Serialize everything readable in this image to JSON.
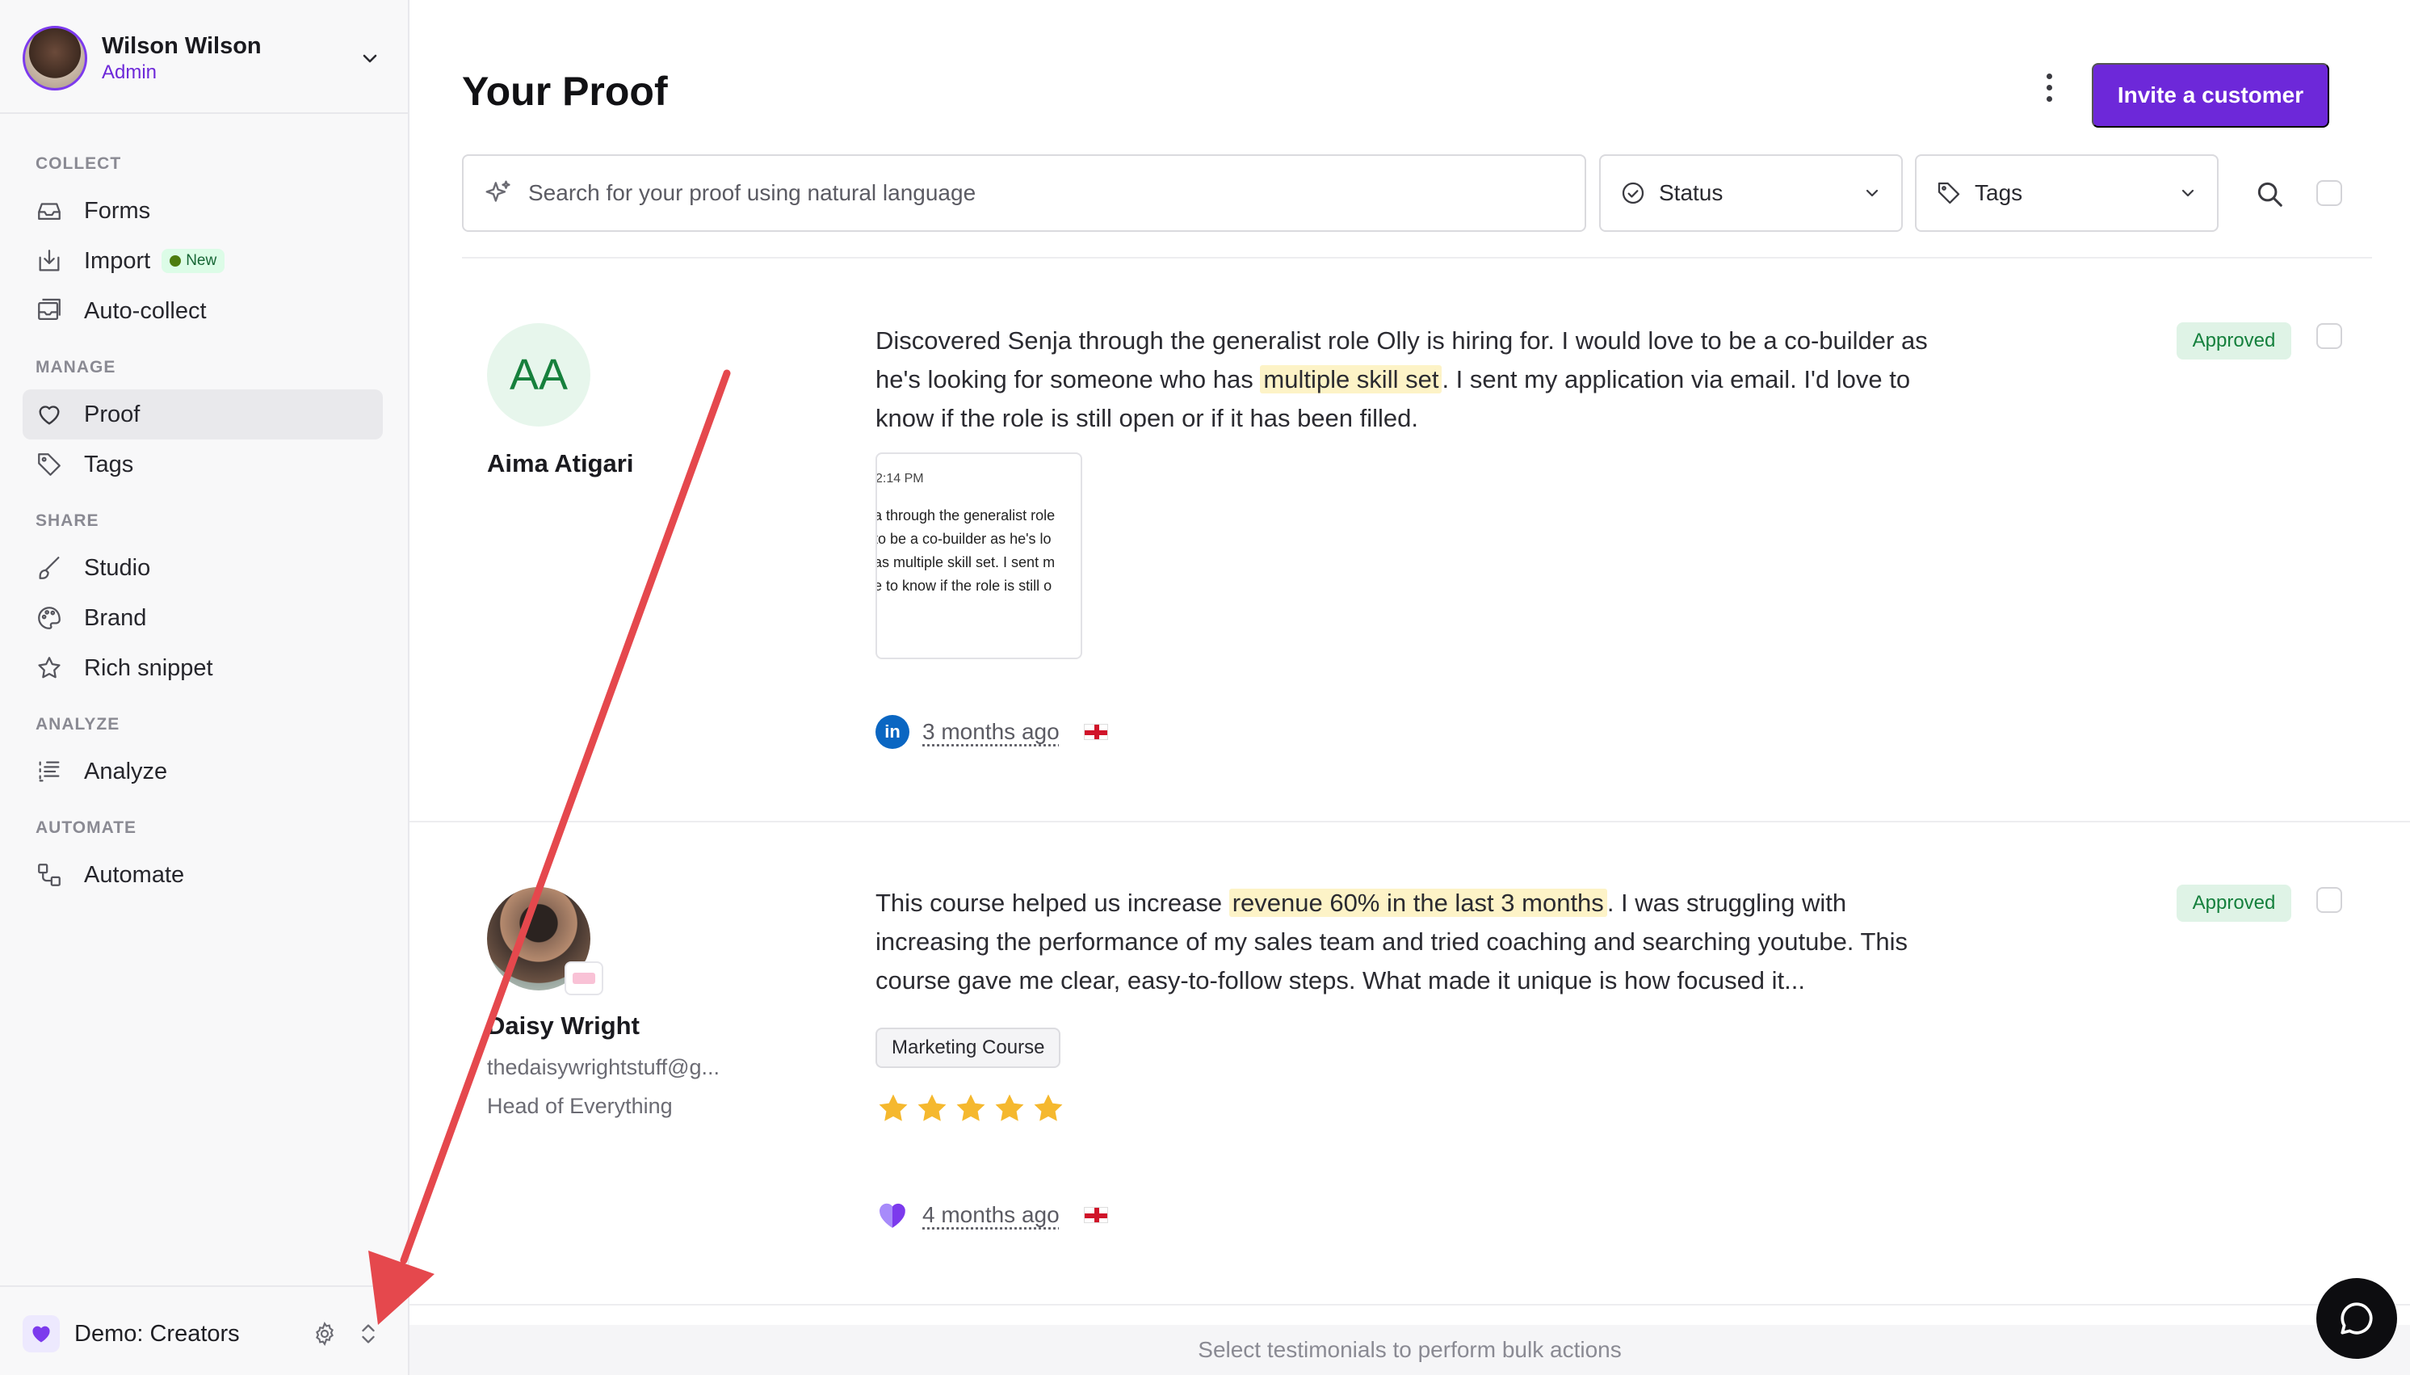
{
  "user": {
    "name": "Wilson Wilson",
    "role": "Admin"
  },
  "sidebar": {
    "sections": [
      {
        "title": "COLLECT",
        "items": [
          {
            "label": "Forms",
            "icon": "inbox-icon"
          },
          {
            "label": "Import",
            "icon": "import-icon",
            "badge": "New"
          },
          {
            "label": "Auto-collect",
            "icon": "auto-collect-icon"
          }
        ]
      },
      {
        "title": "MANAGE",
        "items": [
          {
            "label": "Proof",
            "icon": "heart-icon",
            "active": true
          },
          {
            "label": "Tags",
            "icon": "tag-icon"
          }
        ]
      },
      {
        "title": "SHARE",
        "items": [
          {
            "label": "Studio",
            "icon": "brush-icon"
          },
          {
            "label": "Brand",
            "icon": "palette-icon"
          },
          {
            "label": "Rich snippet",
            "icon": "star-icon"
          }
        ]
      },
      {
        "title": "ANALYZE",
        "items": [
          {
            "label": "Analyze",
            "icon": "analyze-icon"
          }
        ]
      },
      {
        "title": "AUTOMATE",
        "items": [
          {
            "label": "Automate",
            "icon": "automate-icon"
          }
        ]
      }
    ],
    "workspace": {
      "name": "Demo: Creators"
    }
  },
  "header": {
    "title": "Your Proof",
    "invite_label": "Invite a customer"
  },
  "filters": {
    "search_placeholder": "Search for your proof using natural language",
    "status_label": "Status",
    "tags_label": "Tags"
  },
  "testimonials": [
    {
      "initials": "AA",
      "name": "Aima Atigari",
      "quote_before": "Discovered Senja through the generalist role Olly is hiring for. I would love to be a co-builder as he's looking for someone who has ",
      "quote_highlight": "multiple skill set",
      "quote_after": ". I sent my application via email. I'd love to know if the role is still open or if it has been filled.",
      "status": "Approved",
      "attachment": {
        "time": "2:14 PM",
        "lines": [
          "a through the generalist role",
          "to be a co-builder as he's lo",
          "as multiple skill set. I sent m",
          "e to know if the role is still o"
        ]
      },
      "source": "LinkedIn",
      "source_icon_text": "in",
      "time": "3 months ago",
      "flag": "England"
    },
    {
      "name": "Daisy Wright",
      "email": "thedaisywrightstuff@g...",
      "title": "Head of Everything",
      "quote_before": "This course helped us increase ",
      "quote_highlight": "revenue 60% in the last 3 months",
      "quote_after": ". I was struggling with increasing the performance of my sales team and tried coaching and searching youtube. This course gave me clear, easy-to-follow steps. What made it unique is how focused it...",
      "status": "Approved",
      "tag": "Marketing Course",
      "rating": 5,
      "source": "Senja heart",
      "time": "4 months ago",
      "flag": "England"
    }
  ],
  "bulk_bar": {
    "text": "Select testimonials to perform bulk actions"
  },
  "colors": {
    "accent": "#6d28d9",
    "approved_bg": "#dff3e6",
    "approved_text": "#15803d",
    "highlight": "#fdf3c7",
    "annotation_arrow": "#e5484d"
  }
}
